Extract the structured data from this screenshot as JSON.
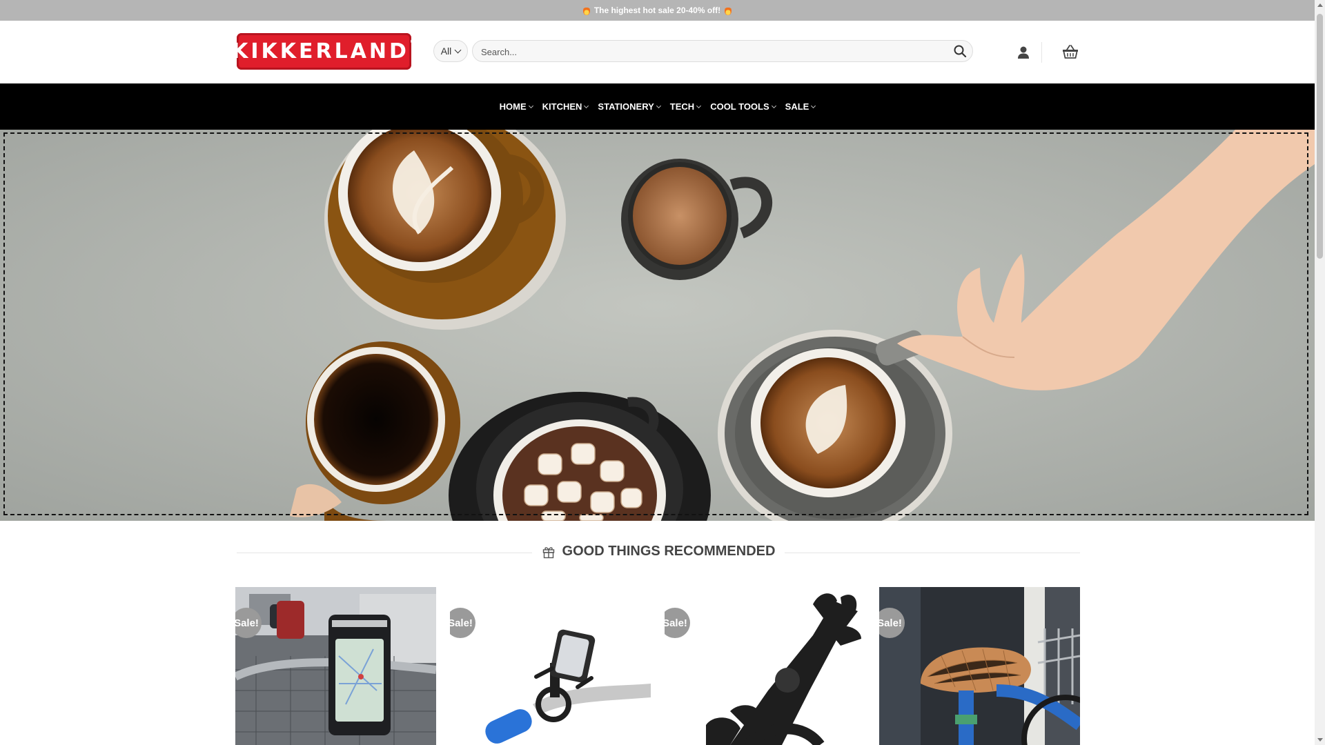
{
  "announcement": {
    "text": "The highest hot sale 20-40% off!"
  },
  "header": {
    "logo_text": "KIKKERLAND",
    "logo_mark": "®",
    "category_select": "All",
    "search_placeholder": "Search..."
  },
  "nav": {
    "items": [
      {
        "label": "HOME"
      },
      {
        "label": "KITCHEN"
      },
      {
        "label": "STATIONERY"
      },
      {
        "label": "TECH"
      },
      {
        "label": "COOL TOOLS"
      },
      {
        "label": "SALE"
      }
    ]
  },
  "section": {
    "title": "GOOD THINGS RECOMMENDED"
  },
  "products": [
    {
      "badge": "Sale!"
    },
    {
      "badge": "Sale!"
    },
    {
      "badge": "Sale!"
    },
    {
      "badge": "Sale!"
    }
  ],
  "colors": {
    "brand_red": "#e01e2b",
    "nav_bg": "#000000",
    "topbar_bg": "#b5b5b5",
    "badge_bg": "#9a9a9a"
  },
  "icons": [
    "flame-icon",
    "chevron-down-icon",
    "search-icon",
    "user-icon",
    "basket-icon",
    "gift-icon"
  ]
}
